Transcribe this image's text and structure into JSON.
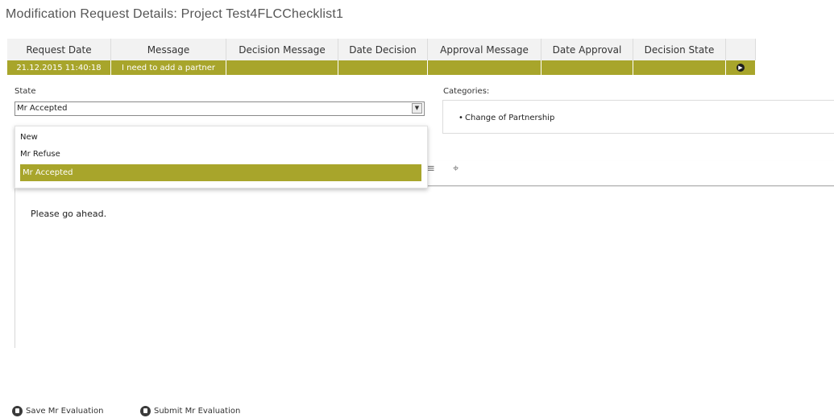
{
  "page": {
    "title": "Modification Request Details: Project Test4FLCChecklist1"
  },
  "table": {
    "headers": [
      "Request Date",
      "Message",
      "Decision Message",
      "Date Decision",
      "Approval Message",
      "Date Approval",
      "Decision State"
    ],
    "row": {
      "request_date": "21.12.2015 11:40:18",
      "message": "I need to add a partner",
      "decision_message": "",
      "date_decision": "",
      "approval_message": "",
      "date_approval": "",
      "decision_state": ""
    }
  },
  "state": {
    "label": "State",
    "selected": "Mr Accepted",
    "options": [
      "New",
      "Mr Refuse",
      "Mr Accepted"
    ]
  },
  "categories": {
    "label": "Categories:",
    "items": [
      "Change of Partnership"
    ]
  },
  "editor": {
    "content": "Please go ahead."
  },
  "actions": {
    "save": "Save Mr Evaluation",
    "submit": "Submit Mr Evaluation"
  },
  "colors": {
    "accent": "#a8a52b"
  }
}
